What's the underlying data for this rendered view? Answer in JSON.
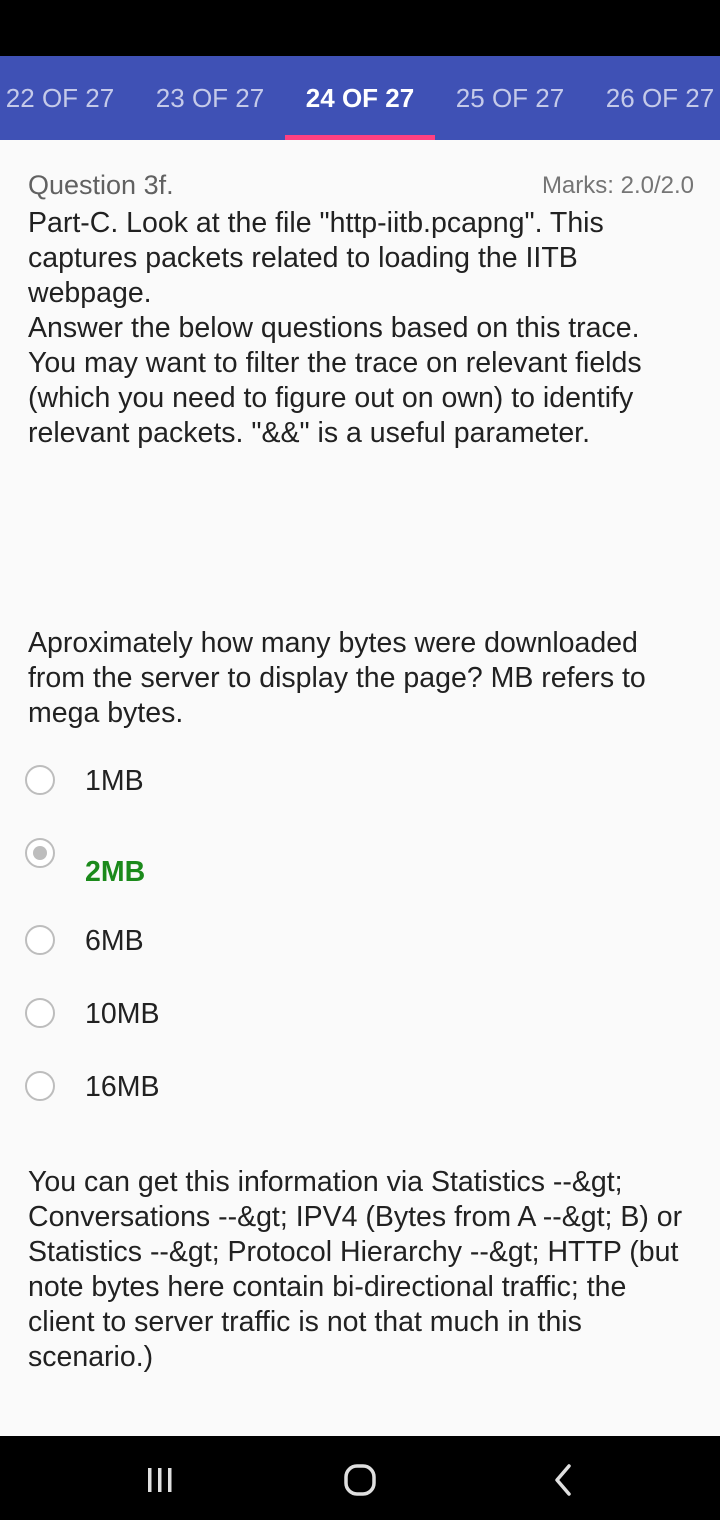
{
  "tabs": [
    {
      "label": "22 OF 27"
    },
    {
      "label": "23 OF 27"
    },
    {
      "label": "24 OF 27"
    },
    {
      "label": "25 OF 27"
    },
    {
      "label": "26 OF 27"
    }
  ],
  "question": {
    "number": "Question 3f.",
    "marks": "Marks: 2.0/2.0",
    "intro": "Part-C. Look at the file \"http-iitb.pcapng\". This captures packets related to loading the IITB webpage.",
    "instructions": "Answer the below questions based on this trace. You may want to filter the trace on relevant fields (which you need to figure out on own) to identify relevant packets. \"&&\" is a useful parameter.",
    "text": "Aproximately how many bytes were downloaded from the server to display the page? MB refers to mega bytes.",
    "options": [
      {
        "label": "1MB"
      },
      {
        "label": "2MB"
      },
      {
        "label": "6MB"
      },
      {
        "label": "10MB"
      },
      {
        "label": "16MB"
      }
    ],
    "feedback": "You can get this information via Statistics --&gt; Conversations --&gt; IPV4 (Bytes from A --&gt; B) or Statistics --&gt; Protocol Hierarchy --&gt; HTTP (but note bytes here contain bi-directional traffic; the client to server traffic is not that much in this scenario.)"
  },
  "colors": {
    "tab_bar": "#3f51b5",
    "tab_indicator": "#ff4081",
    "correct_answer": "#1b8a1b"
  },
  "icons": {
    "recents": "recents-icon",
    "home": "home-icon",
    "back": "back-icon"
  }
}
